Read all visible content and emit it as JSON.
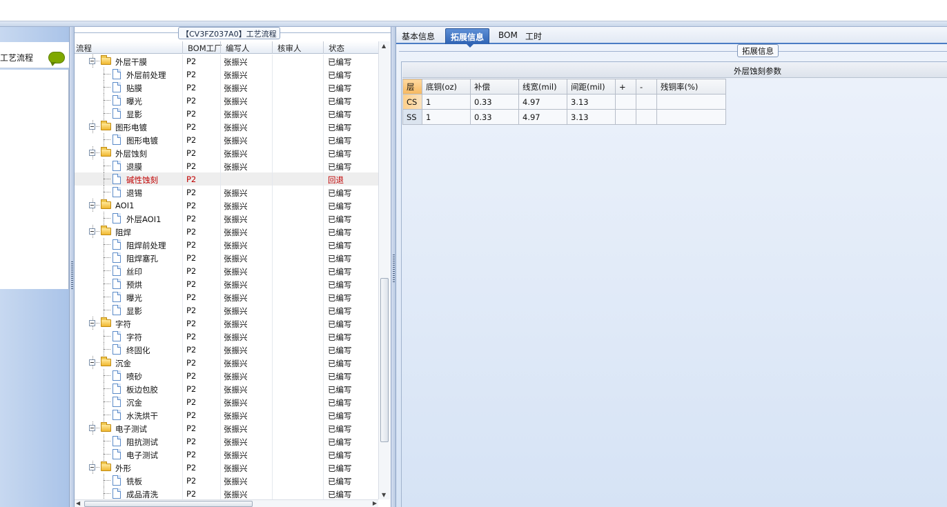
{
  "left_nav": {
    "label": "工艺流程",
    "chat_icon": "speech-bubble-icon"
  },
  "process_panel": {
    "title": "【CV3FZ037A0】工艺流程",
    "columns": [
      "流程",
      "BOM工厂",
      "编写人",
      "核审人",
      "状态"
    ],
    "rows": [
      {
        "name": "外层干膜",
        "kind": "folder",
        "plant": "P2",
        "author": "张振兴",
        "reviewer": "",
        "status": "已编写"
      },
      {
        "name": "外层前处理",
        "kind": "doc",
        "plant": "P2",
        "author": "张振兴",
        "reviewer": "",
        "status": "已编写"
      },
      {
        "name": "贴膜",
        "kind": "doc",
        "plant": "P2",
        "author": "张振兴",
        "reviewer": "",
        "status": "已编写"
      },
      {
        "name": "曝光",
        "kind": "doc",
        "plant": "P2",
        "author": "张振兴",
        "reviewer": "",
        "status": "已编写"
      },
      {
        "name": "显影",
        "kind": "doc",
        "plant": "P2",
        "author": "张振兴",
        "reviewer": "",
        "status": "已编写"
      },
      {
        "name": "图形电镀",
        "kind": "folder",
        "plant": "P2",
        "author": "张振兴",
        "reviewer": "",
        "status": "已编写"
      },
      {
        "name": "图形电镀",
        "kind": "doc",
        "plant": "P2",
        "author": "张振兴",
        "reviewer": "",
        "status": "已编写"
      },
      {
        "name": "外层蚀刻",
        "kind": "folder",
        "plant": "P2",
        "author": "张振兴",
        "reviewer": "",
        "status": "已编写"
      },
      {
        "name": "退膜",
        "kind": "doc",
        "plant": "P2",
        "author": "张振兴",
        "reviewer": "",
        "status": "已编写"
      },
      {
        "name": "碱性蚀刻",
        "kind": "doc",
        "plant": "P2",
        "author": "",
        "reviewer": "",
        "status": "回退",
        "selected": true
      },
      {
        "name": "退锡",
        "kind": "doc",
        "plant": "P2",
        "author": "张振兴",
        "reviewer": "",
        "status": "已编写"
      },
      {
        "name": "AOI1",
        "kind": "folder",
        "plant": "P2",
        "author": "张振兴",
        "reviewer": "",
        "status": "已编写"
      },
      {
        "name": "外层AOI1",
        "kind": "doc",
        "plant": "P2",
        "author": "张振兴",
        "reviewer": "",
        "status": "已编写"
      },
      {
        "name": "阻焊",
        "kind": "folder",
        "plant": "P2",
        "author": "张振兴",
        "reviewer": "",
        "status": "已编写"
      },
      {
        "name": "阻焊前处理",
        "kind": "doc",
        "plant": "P2",
        "author": "张振兴",
        "reviewer": "",
        "status": "已编写"
      },
      {
        "name": "阻焊塞孔",
        "kind": "doc",
        "plant": "P2",
        "author": "张振兴",
        "reviewer": "",
        "status": "已编写"
      },
      {
        "name": "丝印",
        "kind": "doc",
        "plant": "P2",
        "author": "张振兴",
        "reviewer": "",
        "status": "已编写"
      },
      {
        "name": "预烘",
        "kind": "doc",
        "plant": "P2",
        "author": "张振兴",
        "reviewer": "",
        "status": "已编写"
      },
      {
        "name": "曝光",
        "kind": "doc",
        "plant": "P2",
        "author": "张振兴",
        "reviewer": "",
        "status": "已编写"
      },
      {
        "name": "显影",
        "kind": "doc",
        "plant": "P2",
        "author": "张振兴",
        "reviewer": "",
        "status": "已编写"
      },
      {
        "name": "字符",
        "kind": "folder",
        "plant": "P2",
        "author": "张振兴",
        "reviewer": "",
        "status": "已编写"
      },
      {
        "name": "字符",
        "kind": "doc",
        "plant": "P2",
        "author": "张振兴",
        "reviewer": "",
        "status": "已编写"
      },
      {
        "name": "终固化",
        "kind": "doc",
        "plant": "P2",
        "author": "张振兴",
        "reviewer": "",
        "status": "已编写"
      },
      {
        "name": "沉金",
        "kind": "folder",
        "plant": "P2",
        "author": "张振兴",
        "reviewer": "",
        "status": "已编写"
      },
      {
        "name": "喷砂",
        "kind": "doc",
        "plant": "P2",
        "author": "张振兴",
        "reviewer": "",
        "status": "已编写"
      },
      {
        "name": "板边包胶",
        "kind": "doc",
        "plant": "P2",
        "author": "张振兴",
        "reviewer": "",
        "status": "已编写"
      },
      {
        "name": "沉金",
        "kind": "doc",
        "plant": "P2",
        "author": "张振兴",
        "reviewer": "",
        "status": "已编写"
      },
      {
        "name": "水洗烘干",
        "kind": "doc",
        "plant": "P2",
        "author": "张振兴",
        "reviewer": "",
        "status": "已编写"
      },
      {
        "name": "电子测试",
        "kind": "folder",
        "plant": "P2",
        "author": "张振兴",
        "reviewer": "",
        "status": "已编写"
      },
      {
        "name": "阻抗测试",
        "kind": "doc",
        "plant": "P2",
        "author": "张振兴",
        "reviewer": "",
        "status": "已编写"
      },
      {
        "name": "电子测试",
        "kind": "doc",
        "plant": "P2",
        "author": "张振兴",
        "reviewer": "",
        "status": "已编写"
      },
      {
        "name": "外形",
        "kind": "folder",
        "plant": "P2",
        "author": "张振兴",
        "reviewer": "",
        "status": "已编写"
      },
      {
        "name": "铣板",
        "kind": "doc",
        "plant": "P2",
        "author": "张振兴",
        "reviewer": "",
        "status": "已编写"
      },
      {
        "name": "成品清洗",
        "kind": "doc",
        "plant": "P2",
        "author": "张振兴",
        "reviewer": "",
        "status": "已编写"
      }
    ]
  },
  "right_panel": {
    "tabs": [
      "基本信息",
      "拓展信息",
      "BOM",
      "工时"
    ],
    "active_tab": "拓展信息",
    "section_title": "拓展信息",
    "grid_caption": "外层蚀刻参数",
    "grid_columns": [
      "层",
      "底铜(oz)",
      "补偿",
      "线宽(mil)",
      "间距(mil)",
      "+",
      "-",
      "残铜率(%)"
    ],
    "grid_rows": [
      {
        "layer": "CS",
        "base_cu": "1",
        "comp": "0.33",
        "width": "4.97",
        "spacing": "3.13",
        "plus": "",
        "minus": "",
        "residual": ""
      },
      {
        "layer": "SS",
        "base_cu": "1",
        "comp": "0.33",
        "width": "4.97",
        "spacing": "3.13",
        "plus": "",
        "minus": "",
        "residual": ""
      }
    ]
  }
}
